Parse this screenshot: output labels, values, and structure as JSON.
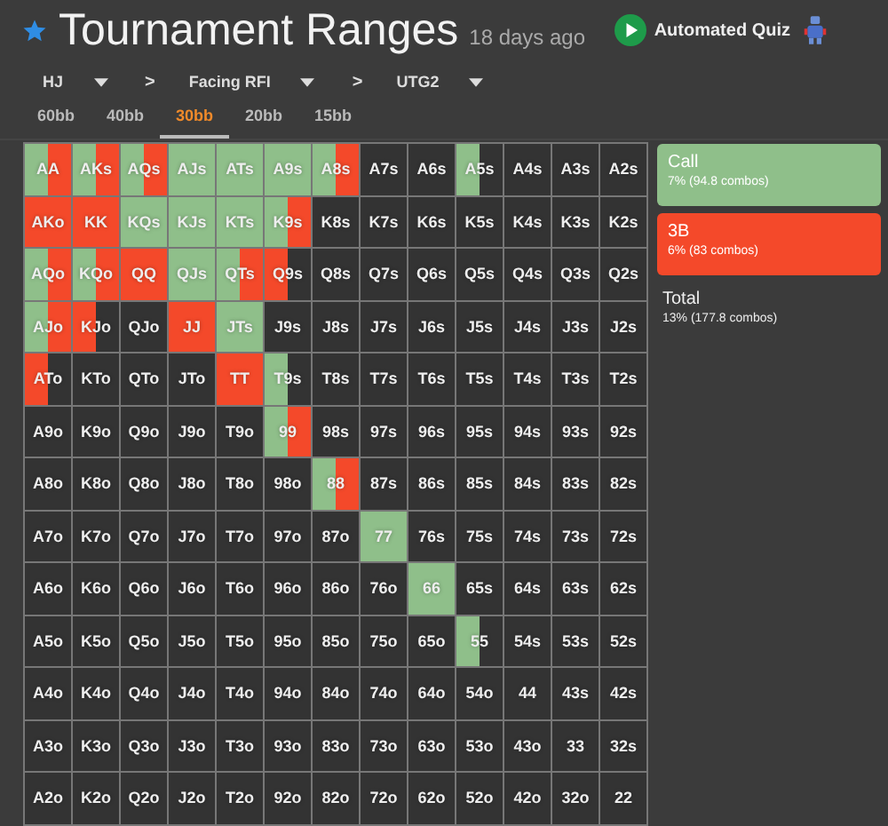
{
  "header": {
    "starred": true,
    "title": "Tournament Ranges",
    "age": "18 days ago",
    "quiz_button": "Automated Quiz"
  },
  "breadcrumb": [
    {
      "label": "HJ"
    },
    {
      "label": "Facing RFI"
    },
    {
      "label": "UTG2"
    }
  ],
  "breadcrumb_separator": ">",
  "tabs": [
    {
      "label": "60bb",
      "selected": false
    },
    {
      "label": "40bb",
      "selected": false
    },
    {
      "label": "30bb",
      "selected": true
    },
    {
      "label": "20bb",
      "selected": false
    },
    {
      "label": "15bb",
      "selected": false
    }
  ],
  "legend": [
    {
      "kind": "call",
      "label": "Call",
      "detail": "7% (94.8 combos)",
      "color": "#8fbf8a"
    },
    {
      "kind": "raise",
      "label": "3B",
      "detail": "6% (83 combos)",
      "color": "#f4492a"
    }
  ],
  "total": {
    "label": "Total",
    "detail": "13% (177.8 combos)"
  },
  "grid": {
    "rows": [
      [
        {
          "hand": "AA",
          "segments": [
            {
              "kind": "call"
            },
            {
              "kind": "raise"
            }
          ]
        },
        {
          "hand": "AKs",
          "segments": [
            {
              "kind": "call"
            },
            {
              "kind": "raise"
            }
          ]
        },
        {
          "hand": "AQs",
          "segments": [
            {
              "kind": "call"
            },
            {
              "kind": "raise"
            }
          ]
        },
        {
          "hand": "AJs",
          "segments": [
            {
              "kind": "call"
            }
          ]
        },
        {
          "hand": "ATs",
          "segments": [
            {
              "kind": "call"
            }
          ]
        },
        {
          "hand": "A9s",
          "segments": [
            {
              "kind": "call"
            }
          ]
        },
        {
          "hand": "A8s",
          "segments": [
            {
              "kind": "call"
            },
            {
              "kind": "raise"
            }
          ]
        },
        {
          "hand": "A7s"
        },
        {
          "hand": "A6s"
        },
        {
          "hand": "A5s",
          "segments": [
            {
              "kind": "call"
            },
            {
              "kind": "fold"
            }
          ]
        },
        {
          "hand": "A4s"
        },
        {
          "hand": "A3s"
        },
        {
          "hand": "A2s"
        }
      ],
      [
        {
          "hand": "AKo",
          "segments": [
            {
              "kind": "raise"
            }
          ]
        },
        {
          "hand": "KK",
          "segments": [
            {
              "kind": "raise"
            }
          ]
        },
        {
          "hand": "KQs",
          "segments": [
            {
              "kind": "call"
            }
          ]
        },
        {
          "hand": "KJs",
          "segments": [
            {
              "kind": "call"
            }
          ]
        },
        {
          "hand": "KTs",
          "segments": [
            {
              "kind": "call"
            }
          ]
        },
        {
          "hand": "K9s",
          "segments": [
            {
              "kind": "call"
            },
            {
              "kind": "raise"
            }
          ]
        },
        {
          "hand": "K8s"
        },
        {
          "hand": "K7s"
        },
        {
          "hand": "K6s"
        },
        {
          "hand": "K5s"
        },
        {
          "hand": "K4s"
        },
        {
          "hand": "K3s"
        },
        {
          "hand": "K2s"
        }
      ],
      [
        {
          "hand": "AQo",
          "segments": [
            {
              "kind": "call"
            },
            {
              "kind": "raise"
            }
          ]
        },
        {
          "hand": "KQo",
          "segments": [
            {
              "kind": "call"
            },
            {
              "kind": "raise"
            }
          ]
        },
        {
          "hand": "QQ",
          "segments": [
            {
              "kind": "raise"
            }
          ]
        },
        {
          "hand": "QJs",
          "segments": [
            {
              "kind": "call"
            }
          ]
        },
        {
          "hand": "QTs",
          "segments": [
            {
              "kind": "call"
            },
            {
              "kind": "raise"
            }
          ]
        },
        {
          "hand": "Q9s",
          "segments": [
            {
              "kind": "raise"
            },
            {
              "kind": "fold"
            }
          ]
        },
        {
          "hand": "Q8s"
        },
        {
          "hand": "Q7s"
        },
        {
          "hand": "Q6s"
        },
        {
          "hand": "Q5s"
        },
        {
          "hand": "Q4s"
        },
        {
          "hand": "Q3s"
        },
        {
          "hand": "Q2s"
        }
      ],
      [
        {
          "hand": "AJo",
          "segments": [
            {
              "kind": "call"
            },
            {
              "kind": "raise"
            }
          ]
        },
        {
          "hand": "KJo",
          "segments": [
            {
              "kind": "raise"
            },
            {
              "kind": "fold"
            }
          ]
        },
        {
          "hand": "QJo"
        },
        {
          "hand": "JJ",
          "segments": [
            {
              "kind": "raise"
            }
          ]
        },
        {
          "hand": "JTs",
          "segments": [
            {
              "kind": "call"
            }
          ]
        },
        {
          "hand": "J9s"
        },
        {
          "hand": "J8s"
        },
        {
          "hand": "J7s"
        },
        {
          "hand": "J6s"
        },
        {
          "hand": "J5s"
        },
        {
          "hand": "J4s"
        },
        {
          "hand": "J3s"
        },
        {
          "hand": "J2s"
        }
      ],
      [
        {
          "hand": "ATo",
          "segments": [
            {
              "kind": "raise"
            },
            {
              "kind": "fold"
            }
          ]
        },
        {
          "hand": "KTo"
        },
        {
          "hand": "QTo"
        },
        {
          "hand": "JTo"
        },
        {
          "hand": "TT",
          "segments": [
            {
              "kind": "raise"
            }
          ]
        },
        {
          "hand": "T9s",
          "segments": [
            {
              "kind": "call"
            },
            {
              "kind": "fold"
            }
          ]
        },
        {
          "hand": "T8s"
        },
        {
          "hand": "T7s"
        },
        {
          "hand": "T6s"
        },
        {
          "hand": "T5s"
        },
        {
          "hand": "T4s"
        },
        {
          "hand": "T3s"
        },
        {
          "hand": "T2s"
        }
      ],
      [
        {
          "hand": "A9o"
        },
        {
          "hand": "K9o"
        },
        {
          "hand": "Q9o"
        },
        {
          "hand": "J9o"
        },
        {
          "hand": "T9o"
        },
        {
          "hand": "99",
          "segments": [
            {
              "kind": "call"
            },
            {
              "kind": "raise"
            }
          ]
        },
        {
          "hand": "98s"
        },
        {
          "hand": "97s"
        },
        {
          "hand": "96s"
        },
        {
          "hand": "95s"
        },
        {
          "hand": "94s"
        },
        {
          "hand": "93s"
        },
        {
          "hand": "92s"
        }
      ],
      [
        {
          "hand": "A8o"
        },
        {
          "hand": "K8o"
        },
        {
          "hand": "Q8o"
        },
        {
          "hand": "J8o"
        },
        {
          "hand": "T8o"
        },
        {
          "hand": "98o"
        },
        {
          "hand": "88",
          "segments": [
            {
              "kind": "call"
            },
            {
              "kind": "raise"
            }
          ]
        },
        {
          "hand": "87s"
        },
        {
          "hand": "86s"
        },
        {
          "hand": "85s"
        },
        {
          "hand": "84s"
        },
        {
          "hand": "83s"
        },
        {
          "hand": "82s"
        }
      ],
      [
        {
          "hand": "A7o"
        },
        {
          "hand": "K7o"
        },
        {
          "hand": "Q7o"
        },
        {
          "hand": "J7o"
        },
        {
          "hand": "T7o"
        },
        {
          "hand": "97o"
        },
        {
          "hand": "87o"
        },
        {
          "hand": "77",
          "segments": [
            {
              "kind": "call"
            }
          ]
        },
        {
          "hand": "76s"
        },
        {
          "hand": "75s"
        },
        {
          "hand": "74s"
        },
        {
          "hand": "73s"
        },
        {
          "hand": "72s"
        }
      ],
      [
        {
          "hand": "A6o"
        },
        {
          "hand": "K6o"
        },
        {
          "hand": "Q6o"
        },
        {
          "hand": "J6o"
        },
        {
          "hand": "T6o"
        },
        {
          "hand": "96o"
        },
        {
          "hand": "86o"
        },
        {
          "hand": "76o"
        },
        {
          "hand": "66",
          "segments": [
            {
              "kind": "call"
            }
          ]
        },
        {
          "hand": "65s"
        },
        {
          "hand": "64s"
        },
        {
          "hand": "63s"
        },
        {
          "hand": "62s"
        }
      ],
      [
        {
          "hand": "A5o"
        },
        {
          "hand": "K5o"
        },
        {
          "hand": "Q5o"
        },
        {
          "hand": "J5o"
        },
        {
          "hand": "T5o"
        },
        {
          "hand": "95o"
        },
        {
          "hand": "85o"
        },
        {
          "hand": "75o"
        },
        {
          "hand": "65o"
        },
        {
          "hand": "55",
          "segments": [
            {
              "kind": "call"
            },
            {
              "kind": "fold"
            }
          ]
        },
        {
          "hand": "54s"
        },
        {
          "hand": "53s"
        },
        {
          "hand": "52s"
        }
      ],
      [
        {
          "hand": "A4o"
        },
        {
          "hand": "K4o"
        },
        {
          "hand": "Q4o"
        },
        {
          "hand": "J4o"
        },
        {
          "hand": "T4o"
        },
        {
          "hand": "94o"
        },
        {
          "hand": "84o"
        },
        {
          "hand": "74o"
        },
        {
          "hand": "64o"
        },
        {
          "hand": "54o"
        },
        {
          "hand": "44"
        },
        {
          "hand": "43s"
        },
        {
          "hand": "42s"
        }
      ],
      [
        {
          "hand": "A3o"
        },
        {
          "hand": "K3o"
        },
        {
          "hand": "Q3o"
        },
        {
          "hand": "J3o"
        },
        {
          "hand": "T3o"
        },
        {
          "hand": "93o"
        },
        {
          "hand": "83o"
        },
        {
          "hand": "73o"
        },
        {
          "hand": "63o"
        },
        {
          "hand": "53o"
        },
        {
          "hand": "43o"
        },
        {
          "hand": "33"
        },
        {
          "hand": "32s"
        }
      ],
      [
        {
          "hand": "A2o"
        },
        {
          "hand": "K2o"
        },
        {
          "hand": "Q2o"
        },
        {
          "hand": "J2o"
        },
        {
          "hand": "T2o"
        },
        {
          "hand": "92o"
        },
        {
          "hand": "82o"
        },
        {
          "hand": "72o"
        },
        {
          "hand": "62o"
        },
        {
          "hand": "52o"
        },
        {
          "hand": "42o"
        },
        {
          "hand": "32o"
        },
        {
          "hand": "22"
        }
      ]
    ]
  }
}
